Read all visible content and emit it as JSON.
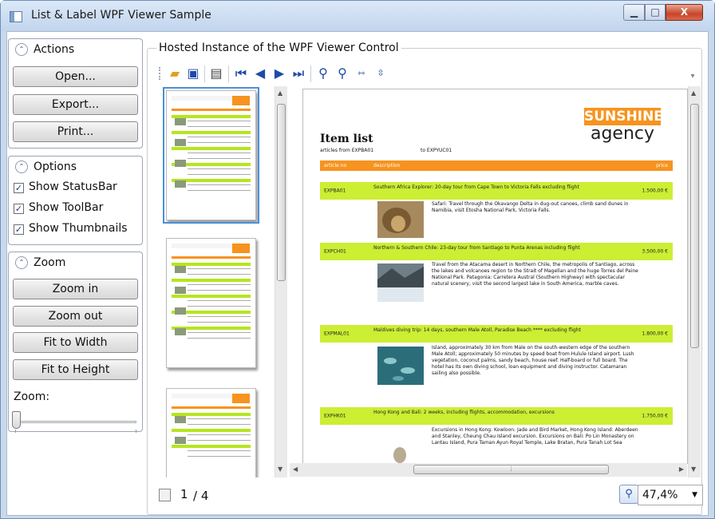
{
  "window": {
    "title": "List & Label WPF Viewer Sample",
    "minimize": "▁",
    "maximize": "□",
    "close": "X"
  },
  "actions": {
    "header": "Actions",
    "open": "Open...",
    "export": "Export...",
    "print": "Print..."
  },
  "options": {
    "header": "Options",
    "show_statusbar": "Show StatusBar",
    "show_toolbar": "Show ToolBar",
    "show_thumbnails": "Show Thumbnails",
    "checked_mark": "✓"
  },
  "zoom": {
    "header": "Zoom",
    "zoom_in": "Zoom in",
    "zoom_out": "Zoom out",
    "fit_width": "Fit to Width",
    "fit_height": "Fit to Height",
    "zoom_label": "Zoom:",
    "slider_level": 0
  },
  "viewer": {
    "group_title": "Hosted Instance of the WPF Viewer Control"
  },
  "report": {
    "title": "Item list",
    "subtitle_from": "articles from EXPBA01",
    "subtitle_to": "to EXPYUC01",
    "logo_top": "SUNSHINE",
    "logo_bottom": "agency",
    "col_no": "article no",
    "col_desc": "description",
    "col_price": "price",
    "items": [
      {
        "no": "EXPBA01",
        "desc": "Southern Africa Explorer: 20-day tour from Cape Town to Victoria Falls excluding flight",
        "price": "1.500,00 €",
        "detail": "Safari: Travel through the Okavango Delta in dug-out canoes, climb sand dunes in Namibia, visit Etosha National Park, Victoria Falls."
      },
      {
        "no": "EXPCH01",
        "desc": "Northern & Southern Chile: 23-day tour from Santiago to Punta Arenas including flight",
        "price": "3.500,00 €",
        "detail": "Travel from the Atacama desert in Northern Chile, the metropolis of Santiago, across the lakes and volcanoes region to the Strait of Magellan and the huge Torres del Paine National Park. Patagonia: Carretera Austral (Southern Highway) with spectacular natural scenery, visit the second largest lake in South America, marble caves."
      },
      {
        "no": "EXPMAL01",
        "desc": "Maldives diving trip: 14 days, southern Male Atoll, Paradise Beach **** excluding flight",
        "price": "1.800,00 €",
        "detail": "Island, approximately 30 km from Male on the south-western edge of the southern Male Atoll; approximately 50 minutes by speed boat from Hulule Island airport. Lush vegetation, coconut palms, sandy beach, house reef. Half-board or full board. The hotel has its own diving school, loan equipment and diving instructor. Catamaran sailing also possible."
      },
      {
        "no": "EXPHK01",
        "desc": "Hong Kong and Bali: 2 weeks, including flights, accommodation, excursions",
        "price": "1.750,00 €",
        "detail": "Excursions in Hong Kong: Kowloon: Jade and Bird Market, Hong Kong Island: Aberdeen and Stanley, Cheung Chau Island excursion. Excursions on Bali: Po Lin Monastery on Lantau Island, Pura Taman Ayun Royal Temple, Lake Bratan, Pura Tanah Lot Sea"
      }
    ]
  },
  "thumbs": {
    "headers": [
      "Item list",
      "Item list (cont.)",
      "Item list (cont.)"
    ]
  },
  "status": {
    "current_page": "1",
    "page_total": "/ 4",
    "zoom_value": "47,4%"
  },
  "colors": {
    "accent_orange": "#f7931e",
    "row_green": "#ccee33",
    "selection_blue": "#4a8fd6"
  }
}
